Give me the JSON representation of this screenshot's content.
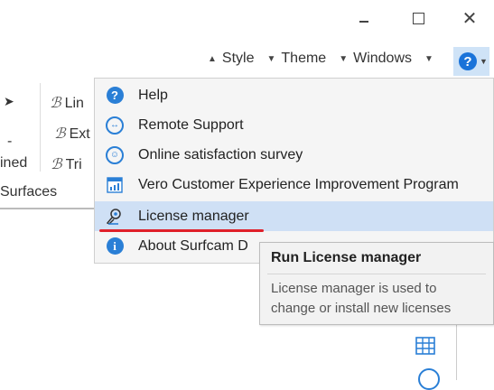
{
  "window_controls": {
    "minimize": "minimize",
    "maximize": "maximize",
    "close": "close"
  },
  "quickbar": {
    "style_label": "Style",
    "theme_label": "Theme",
    "windows_label": "Windows",
    "help_label": "?"
  },
  "ribbon": {
    "lin": "Lin",
    "ext": "Ext",
    "tri": "Tri",
    "ined": "ined",
    "surfaces": "Surfaces"
  },
  "menu": {
    "items": [
      {
        "label": "Help",
        "icon": "help-icon"
      },
      {
        "label": "Remote Support",
        "icon": "remote-support-icon"
      },
      {
        "label": "Online satisfaction survey",
        "icon": "survey-smiley-icon"
      },
      {
        "label": "Vero Customer Experience Improvement Program",
        "icon": "chart-icon"
      },
      {
        "label": "License manager",
        "icon": "license-icon",
        "highlighted": true
      },
      {
        "label": "About Surfcam D",
        "icon": "info-icon"
      }
    ]
  },
  "tooltip": {
    "title": "Run License manager",
    "body": "License manager is used to change or install new licenses"
  },
  "colors": {
    "accent": "#1a73d9",
    "highlight": "#cfe0f5",
    "underline": "#e0202a"
  }
}
